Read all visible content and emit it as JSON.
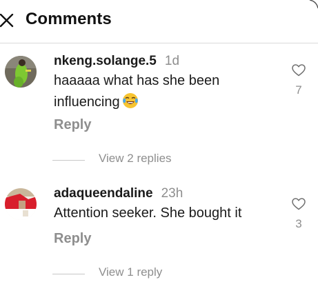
{
  "header": {
    "title": "Comments",
    "close_icon": "close-icon"
  },
  "comments": [
    {
      "username": "nkeng.solange.5",
      "time": "1d",
      "text": "haaaaa what has she been influencing",
      "emoji": "face-with-tears-of-joy",
      "reply_label": "Reply",
      "like_icon": "heart-outline-icon",
      "like_count": "7",
      "view_replies_label": "View 2 replies"
    },
    {
      "username": "adaqueendaline",
      "time": "23h",
      "text": "Attention seeker. She bought it",
      "reply_label": "Reply",
      "like_icon": "heart-outline-icon",
      "like_count": "3",
      "view_replies_label": "View 1 reply"
    }
  ],
  "colors": {
    "text": "#1a1a1a",
    "secondary": "#8e8e8e",
    "divider": "#dadada"
  }
}
